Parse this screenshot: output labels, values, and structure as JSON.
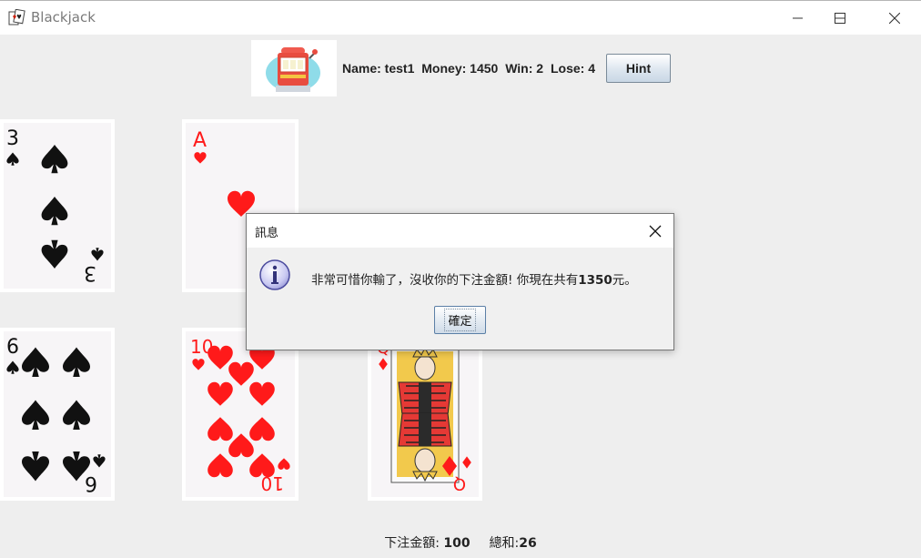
{
  "window": {
    "title": "Blackjack"
  },
  "header": {
    "name_text": "Name: test1",
    "money_text": "Money: 1450",
    "win_text": "Win: 2",
    "lose_text": "Lose: 4",
    "hint_label": "Hint"
  },
  "cards": {
    "top": [
      {
        "rank": "3",
        "suit": "spade",
        "color": "#111111"
      },
      {
        "rank": "A",
        "suit": "heart",
        "color": "#ff1a1a"
      }
    ],
    "bottom": [
      {
        "rank": "6",
        "suit": "spade",
        "color": "#111111"
      },
      {
        "rank": "10",
        "suit": "heart",
        "color": "#ff1a1a"
      },
      {
        "rank": "Q",
        "suit": "diamond",
        "color": "#ff1a1a"
      }
    ]
  },
  "dialog": {
    "title": "訊息",
    "message_prefix": "非常可惜你輸了，沒收你的下注金額! 你現在共有",
    "message_amount": "1350",
    "message_suffix": "元。",
    "ok_label": "確定"
  },
  "footer": {
    "bet_label": "下注金額:",
    "bet_value": "100",
    "sum_label": "總和:",
    "sum_value": "26"
  },
  "colors": {
    "background": "#eeeeee",
    "heart_red": "#ff1a1a",
    "spade_black": "#111111",
    "button_border": "#7a8a99"
  }
}
